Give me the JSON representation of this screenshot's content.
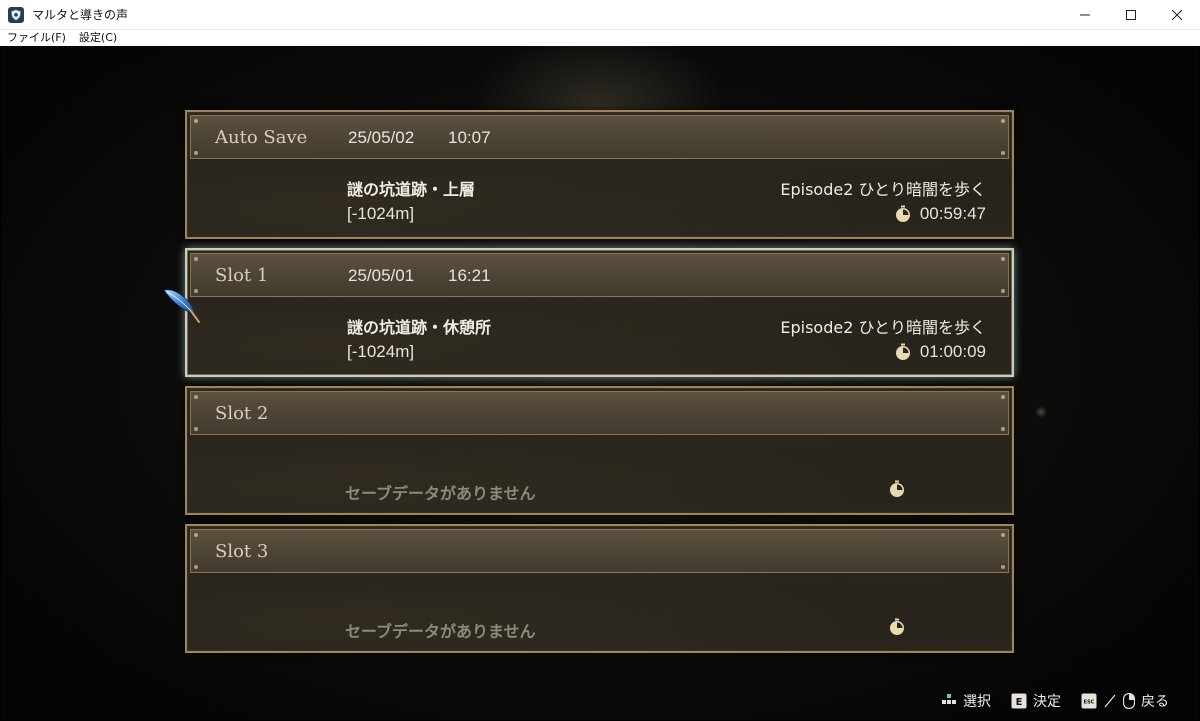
{
  "window": {
    "title": "マルタと導きの声",
    "menu": [
      {
        "label": "ファイル(F)"
      },
      {
        "label": "設定(C)"
      }
    ]
  },
  "slots": [
    {
      "name": "Auto Save",
      "date": "25/05/02",
      "time": "10:07",
      "location": "謎の坑道跡・上層",
      "depth": "[-1024m]",
      "episode": "Episode2 ひとり暗闇を歩く",
      "playtime": "00:59:47",
      "selected": false
    },
    {
      "name": "Slot 1",
      "date": "25/05/01",
      "time": "16:21",
      "location": "謎の坑道跡・休憩所",
      "depth": "[-1024m]",
      "episode": "Episode2 ひとり暗闇を歩く",
      "playtime": "01:00:09",
      "selected": true
    },
    {
      "name": "Slot 2",
      "empty_text": "セーブデータがありません"
    },
    {
      "name": "Slot 3",
      "empty_text": "セーブデータがありません"
    }
  ],
  "guide": {
    "select_label": "選択",
    "confirm_key": "E",
    "confirm_label": "決定",
    "back_key": "ESC",
    "back_label": "戻る"
  },
  "colors": {
    "frame_gold": "#a0845a",
    "selected_frame": "#c7cdbf",
    "text_primary": "#f0ece4",
    "text_empty": "#8e897e"
  },
  "icons": {
    "cursor": "quill-icon",
    "playtime": "stopwatch-icon",
    "select": "dpad-icon",
    "confirm": "e-key-icon",
    "back": "esc-key-icon",
    "back_alt": "mouse-right-icon"
  }
}
